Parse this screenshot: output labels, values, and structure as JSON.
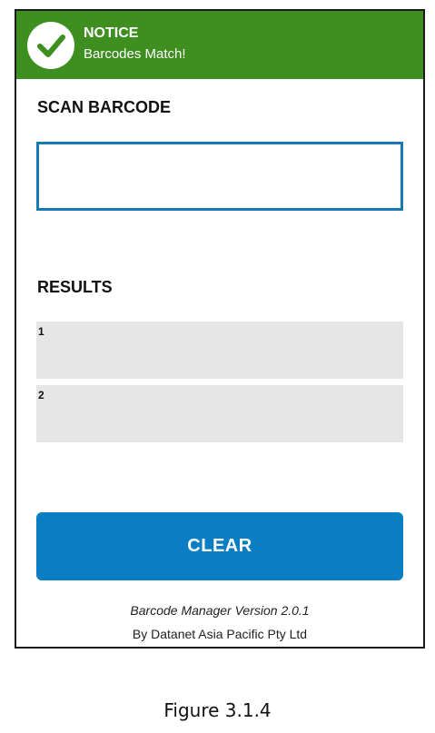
{
  "notice": {
    "title": "NOTICE",
    "message": "Barcodes Match!",
    "color": "#3e8e20",
    "icon": "check-circle-icon"
  },
  "scan": {
    "label": "SCAN BARCODE",
    "value": "",
    "border_color": "#1a78b4"
  },
  "results": {
    "label": "RESULTS",
    "items": [
      {
        "num": "1",
        "value": ""
      },
      {
        "num": "2",
        "value": ""
      }
    ]
  },
  "clear_button": {
    "label": "CLEAR",
    "color": "#0b7ec3"
  },
  "footer": {
    "version": "Barcode Manager Version 2.0.1",
    "company": "By Datanet Asia Pacific Pty Ltd"
  },
  "caption": "Figure 3.1.4"
}
